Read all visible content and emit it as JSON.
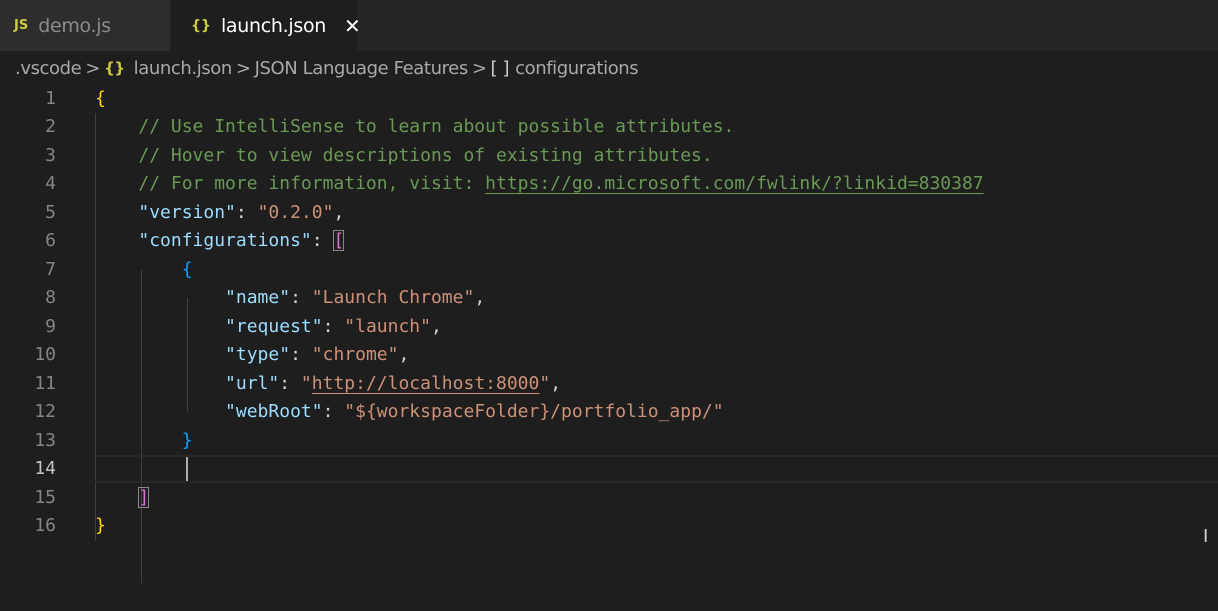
{
  "tabs": [
    {
      "icon": "JS",
      "label": "demo.js"
    },
    {
      "icon": "{}",
      "label": "launch.json",
      "close": "✕"
    }
  ],
  "breadcrumb": {
    "folder": ".vscode",
    "file_icon": "{}",
    "file": "launch.json",
    "section": "JSON Language Features",
    "array_icon": "[ ]",
    "symbol": "configurations",
    "separator": ">"
  },
  "editor": {
    "current_line": 14,
    "lines": [
      {
        "num": "1",
        "tokens": [
          {
            "t": "{",
            "c": "brace-1"
          }
        ]
      },
      {
        "num": "2",
        "tokens": [
          {
            "t": "    "
          },
          {
            "t": "// Use IntelliSense to learn about possible attributes.",
            "c": "c-comment"
          }
        ]
      },
      {
        "num": "3",
        "tokens": [
          {
            "t": "    "
          },
          {
            "t": "// Hover to view descriptions of existing attributes.",
            "c": "c-comment"
          }
        ]
      },
      {
        "num": "4",
        "tokens": [
          {
            "t": "    "
          },
          {
            "t": "// For more information, visit: ",
            "c": "c-comment"
          },
          {
            "t": "https://go.microsoft.com/fwlink/?linkid=830387",
            "c": "c-link"
          }
        ]
      },
      {
        "num": "5",
        "tokens": [
          {
            "t": "    "
          },
          {
            "t": "\"version\"",
            "c": "c-key"
          },
          {
            "t": ": ",
            "c": "c-punc"
          },
          {
            "t": "\"0.2.0\"",
            "c": "c-str"
          },
          {
            "t": ",",
            "c": "c-punc"
          }
        ]
      },
      {
        "num": "6",
        "tokens": [
          {
            "t": "    "
          },
          {
            "t": "\"configurations\"",
            "c": "c-key"
          },
          {
            "t": ": ",
            "c": "c-punc"
          },
          {
            "t": "[",
            "c": "brace-2 bracket-box"
          }
        ]
      },
      {
        "num": "7",
        "tokens": [
          {
            "t": "        "
          },
          {
            "t": "{",
            "c": "brace-3"
          }
        ]
      },
      {
        "num": "8",
        "tokens": [
          {
            "t": "            "
          },
          {
            "t": "\"name\"",
            "c": "c-key"
          },
          {
            "t": ": ",
            "c": "c-punc"
          },
          {
            "t": "\"Launch Chrome\"",
            "c": "c-str"
          },
          {
            "t": ",",
            "c": "c-punc"
          }
        ]
      },
      {
        "num": "9",
        "tokens": [
          {
            "t": "            "
          },
          {
            "t": "\"request\"",
            "c": "c-key"
          },
          {
            "t": ": ",
            "c": "c-punc"
          },
          {
            "t": "\"launch\"",
            "c": "c-str"
          },
          {
            "t": ",",
            "c": "c-punc"
          }
        ]
      },
      {
        "num": "10",
        "tokens": [
          {
            "t": "            "
          },
          {
            "t": "\"type\"",
            "c": "c-key"
          },
          {
            "t": ": ",
            "c": "c-punc"
          },
          {
            "t": "\"chrome\"",
            "c": "c-str"
          },
          {
            "t": ",",
            "c": "c-punc"
          }
        ]
      },
      {
        "num": "11",
        "tokens": [
          {
            "t": "            "
          },
          {
            "t": "\"url\"",
            "c": "c-key"
          },
          {
            "t": ": ",
            "c": "c-punc"
          },
          {
            "t": "\"",
            "c": "c-str"
          },
          {
            "t": "http://localhost:8000",
            "c": "c-str-link"
          },
          {
            "t": "\"",
            "c": "c-str"
          },
          {
            "t": ",",
            "c": "c-punc"
          }
        ]
      },
      {
        "num": "12",
        "tokens": [
          {
            "t": "            "
          },
          {
            "t": "\"webRoot\"",
            "c": "c-key"
          },
          {
            "t": ": ",
            "c": "c-punc"
          },
          {
            "t": "\"${workspaceFolder}/portfolio_app/\"",
            "c": "c-str"
          }
        ]
      },
      {
        "num": "13",
        "tokens": [
          {
            "t": "        "
          },
          {
            "t": "}",
            "c": "brace-3"
          }
        ]
      },
      {
        "num": "14",
        "tokens": [
          {
            "t": ""
          }
        ]
      },
      {
        "num": "15",
        "tokens": [
          {
            "t": "    "
          },
          {
            "t": "]",
            "c": "brace-2 bracket-box"
          }
        ]
      },
      {
        "num": "16",
        "tokens": [
          {
            "t": "}",
            "c": "brace-1"
          }
        ]
      }
    ]
  },
  "colors": {
    "background": "#1e1e1e",
    "comment": "#6a9955",
    "key": "#9cdcfe",
    "string": "#ce9178",
    "brace_level1": "#ffd700",
    "brace_level2": "#da70d6",
    "brace_level3": "#179fff"
  }
}
